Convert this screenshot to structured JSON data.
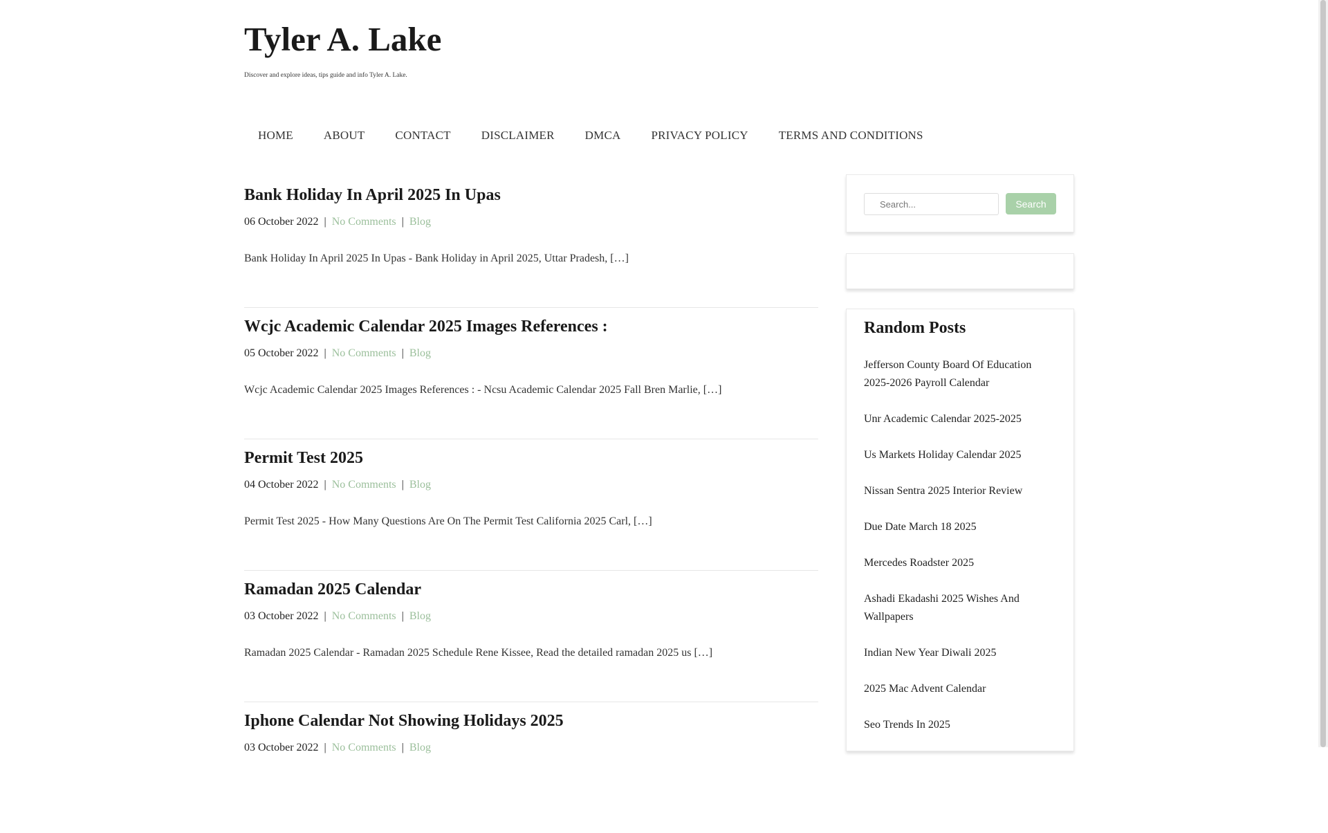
{
  "site": {
    "title": "Tyler A. Lake",
    "description": "Discover and explore ideas, tips guide and info Tyler A. Lake."
  },
  "nav": [
    "HOME",
    "ABOUT",
    "CONTACT",
    "DISCLAIMER",
    "DMCA",
    "PRIVACY POLICY",
    "TERMS AND CONDITIONS"
  ],
  "posts": [
    {
      "title": "Bank Holiday In April 2025 In Upas",
      "date": "06 October 2022",
      "comments": "No Comments",
      "category": "Blog",
      "excerpt": "Bank Holiday In April 2025 In Upas - Bank Holiday in April 2025, Uttar Pradesh, […]"
    },
    {
      "title": "Wcjc Academic Calendar 2025 Images References :",
      "date": "05 October 2022",
      "comments": "No Comments",
      "category": "Blog",
      "excerpt": "Wcjc Academic Calendar 2025 Images References : - Ncsu Academic Calendar 2025 Fall Bren Marlie, […]"
    },
    {
      "title": "Permit Test 2025",
      "date": "04 October 2022",
      "comments": "No Comments",
      "category": "Blog",
      "excerpt": "Permit Test 2025 - How Many Questions Are On The Permit Test California 2025 Carl, […]"
    },
    {
      "title": "Ramadan 2025 Calendar",
      "date": "03 October 2022",
      "comments": "No Comments",
      "category": "Blog",
      "excerpt": "Ramadan 2025 Calendar - Ramadan 2025 Schedule Rene Kissee, Read the detailed ramadan 2025 us […]"
    },
    {
      "title": "Iphone Calendar Not Showing Holidays 2025",
      "date": "03 October 2022",
      "comments": "No Comments",
      "category": "Blog",
      "excerpt": ""
    }
  ],
  "search": {
    "placeholder": "Search...",
    "button": "Search"
  },
  "random_posts": {
    "heading": "Random Posts",
    "items": [
      "Jefferson County Board Of Education 2025-2026 Payroll Calendar",
      "Unr Academic Calendar 2025-2025",
      "Us Markets Holiday Calendar 2025",
      "Nissan Sentra 2025 Interior Review",
      "Due Date March 18 2025",
      "Mercedes Roadster 2025",
      "Ashadi Ekadashi 2025 Wishes And Wallpapers",
      "Indian New Year Diwali 2025",
      "2025 Mac Advent Calendar",
      "Seo Trends In 2025"
    ]
  },
  "colors": {
    "link": "#9bbf9b",
    "search_button": "#a9d1a9"
  }
}
